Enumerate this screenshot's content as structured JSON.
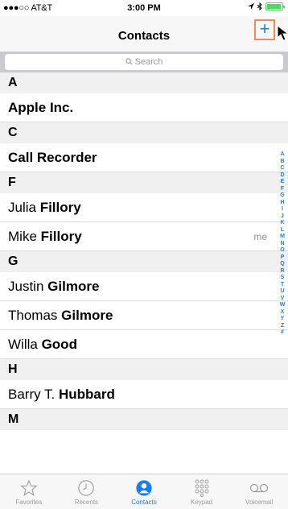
{
  "status": {
    "carrier": "●●●○○ AT&T",
    "time": "3:00 PM"
  },
  "navbar": {
    "title": "Contacts",
    "add_label": "+"
  },
  "search": {
    "placeholder": "Search"
  },
  "sections": [
    {
      "letter": "A",
      "contacts": [
        {
          "first": "Apple Inc.",
          "last": "",
          "meta": ""
        }
      ]
    },
    {
      "letter": "C",
      "contacts": [
        {
          "first": "Call Recorder",
          "last": "",
          "meta": ""
        }
      ]
    },
    {
      "letter": "F",
      "contacts": [
        {
          "first": "Julia",
          "last": "Fillory",
          "meta": ""
        },
        {
          "first": "Mike",
          "last": "Fillory",
          "meta": "me"
        }
      ]
    },
    {
      "letter": "G",
      "contacts": [
        {
          "first": "Justin",
          "last": "Gilmore",
          "meta": ""
        },
        {
          "first": "Thomas",
          "last": "Gilmore",
          "meta": ""
        },
        {
          "first": "Willa",
          "last": "Good",
          "meta": ""
        }
      ]
    },
    {
      "letter": "H",
      "contacts": [
        {
          "first": "Barry T.",
          "last": "Hubbard",
          "meta": ""
        }
      ]
    },
    {
      "letter": "M",
      "contacts": []
    }
  ],
  "index_letters": [
    "A",
    "B",
    "C",
    "D",
    "E",
    "F",
    "G",
    "H",
    "I",
    "J",
    "K",
    "L",
    "M",
    "N",
    "O",
    "P",
    "Q",
    "R",
    "S",
    "T",
    "U",
    "V",
    "W",
    "X",
    "Y",
    "Z",
    "#"
  ],
  "tabs": [
    {
      "label": "Favorites",
      "icon": "star-icon",
      "active": false
    },
    {
      "label": "Recents",
      "icon": "clock-icon",
      "active": false
    },
    {
      "label": "Contacts",
      "icon": "contact-icon",
      "active": true
    },
    {
      "label": "Keypad",
      "icon": "keypad-icon",
      "active": false
    },
    {
      "label": "Voicemail",
      "icon": "voicemail-icon",
      "active": false
    }
  ],
  "colors": {
    "accent": "#1a7cf5",
    "highlight": "#f28b5c",
    "battery": "#4cd964"
  }
}
